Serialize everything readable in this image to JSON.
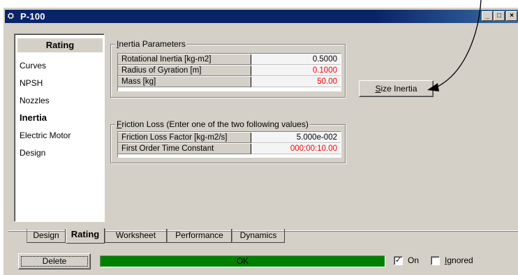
{
  "window": {
    "title": "P-100",
    "app_icon": "pump-icon",
    "controls": [
      "_",
      "□",
      "×"
    ]
  },
  "nav": {
    "header": "Rating",
    "items": [
      {
        "label": "Curves",
        "active": false
      },
      {
        "label": "NPSH",
        "active": false
      },
      {
        "label": "Nozzles",
        "active": false
      },
      {
        "label": "Inertia",
        "active": true
      },
      {
        "label": "Electric Motor",
        "active": false
      },
      {
        "label": "Design",
        "active": false
      }
    ]
  },
  "inertia": {
    "legend_accel": "I",
    "legend_rest": "nertia Parameters",
    "rows": [
      {
        "label": "Rotational Inertia [kg-m2]",
        "value": "0.5000",
        "color": "#000000"
      },
      {
        "label": "Radius of Gyration [m]",
        "value": "0.1000",
        "color": "#ff0000"
      },
      {
        "label": "Mass [kg]",
        "value": "50.00",
        "color": "#ff0000"
      }
    ]
  },
  "size_button": {
    "accel": "S",
    "rest": "ize Inertia"
  },
  "friction": {
    "legend_accel": "F",
    "legend_rest": "riction Loss (Enter one of the two following values)",
    "rows": [
      {
        "label": "Friction Loss Factor [kg-m2/s]",
        "value": "5.000e-002",
        "color": "#000000"
      },
      {
        "label": "First Order Time Constant",
        "value": "000:00:10.00",
        "color": "#ff0000"
      }
    ]
  },
  "tabs": [
    {
      "label": "Design",
      "active": false
    },
    {
      "label": "Rating",
      "active": true
    },
    {
      "label": "Worksheet",
      "active": false
    },
    {
      "label": "Performance",
      "active": false
    },
    {
      "label": "Dynamics",
      "active": false
    }
  ],
  "footer": {
    "delete_label": "Delete",
    "status_text": "OK",
    "status_color": "#008000",
    "on_label": "On",
    "on_checked": true,
    "ignored_accel": "I",
    "ignored_rest": "gnored",
    "ignored_checked": false
  }
}
